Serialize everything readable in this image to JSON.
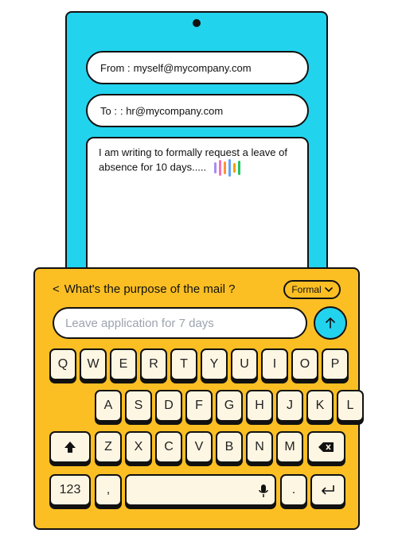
{
  "email": {
    "from_label": "From :",
    "from_value": "myself@mycompany.com",
    "to_label": "To :",
    "to_value": ": hr@mycompany.com",
    "body_text": "I am writing to formally request a leave of absence for 10 days.....",
    "wave_colors": [
      "#a78bfa",
      "#f472b6",
      "#fb923c",
      "#60a5fa",
      "#f59e0b",
      "#22c55e"
    ]
  },
  "assistant": {
    "back_glyph": "<",
    "question": "What's the purpose of the mail ?",
    "tone_label": "Formal",
    "prompt_placeholder": "Leave application for 7 days"
  },
  "keyboard": {
    "row1": [
      "Q",
      "W",
      "E",
      "R",
      "T",
      "Y",
      "U",
      "I",
      "O",
      "P"
    ],
    "row2": [
      "A",
      "S",
      "D",
      "F",
      "G",
      "H",
      "J",
      "K",
      "L"
    ],
    "row3": [
      "Z",
      "X",
      "C",
      "V",
      "B",
      "N",
      "M"
    ],
    "numbers_label": "123",
    "comma_label": ",",
    "period_label": "."
  },
  "colors": {
    "phone": "#22d3ee",
    "keyboard": "#fbbf24",
    "key": "#fdf6e3"
  }
}
